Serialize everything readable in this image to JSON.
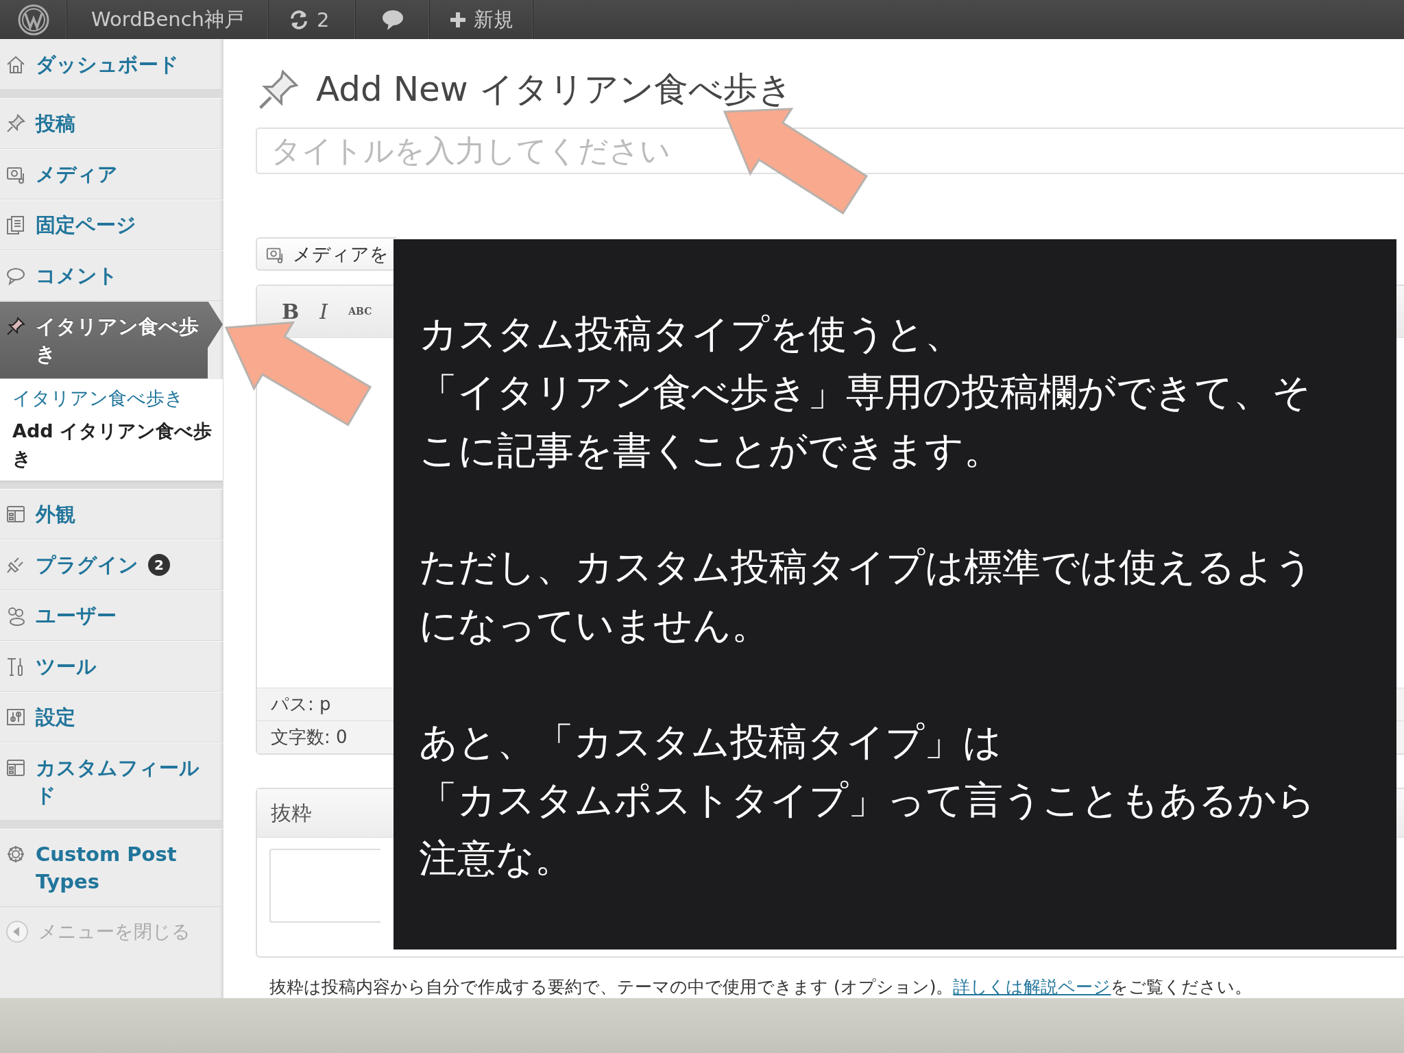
{
  "admin_bar": {
    "site_name": "WordBench神戸",
    "updates_count": "2",
    "new_label": "新規"
  },
  "sidebar": {
    "groups": [
      [
        {
          "label": "ダッシュボード",
          "selected": false
        }
      ],
      [
        {
          "label": "投稿",
          "selected": false
        },
        {
          "label": "メディア",
          "selected": false
        },
        {
          "label": "固定ページ",
          "selected": false
        },
        {
          "label": "コメント",
          "selected": false
        },
        {
          "label": "イタリアン食べ歩き",
          "selected": true,
          "children": [
            {
              "label": "イタリアン食べ歩き",
              "selected": false
            },
            {
              "label": "Add イタリアン食べ歩き",
              "selected": true
            }
          ]
        }
      ],
      [
        {
          "label": "外観",
          "selected": false
        },
        {
          "label": "プラグイン",
          "selected": false,
          "badge": "2"
        },
        {
          "label": "ユーザー",
          "selected": false
        },
        {
          "label": "ツール",
          "selected": false
        },
        {
          "label": "設定",
          "selected": false
        },
        {
          "label": "カスタムフィールド",
          "selected": false
        }
      ],
      [
        {
          "label": "Custom Post Types",
          "selected": false
        }
      ]
    ],
    "collapse_label": "メニューを閉じる"
  },
  "editor": {
    "heading": "Add New イタリアン食べ歩き",
    "title_placeholder": "タイトルを入力してください",
    "media_button": "メディアを",
    "toolbar": [
      "B",
      "I",
      "ABC"
    ],
    "path": "パス: p",
    "word_count": "文字数: 0",
    "excerpt": {
      "title": "抜粋",
      "help": "抜粋は投稿内容から自分で作成する要約で、テーマの中で使用できます (オプション)。",
      "help_link": "詳しくは解説ページ",
      "help_after": "をご覧ください。"
    }
  },
  "overlay": {
    "paragraphs": [
      [
        "カスタム投稿タイプを使うと、",
        "「イタリアン食べ歩き」専用の投稿欄ができて、そ",
        "こに記事を書くことができます。"
      ],
      [
        "ただし、カスタム投稿タイプは標準では使えるよう",
        "になっていません。"
      ],
      [
        "あと、「カスタム投稿タイプ」は",
        "「カスタムポストタイプ」って言うこともあるから",
        "注意な。"
      ]
    ]
  }
}
